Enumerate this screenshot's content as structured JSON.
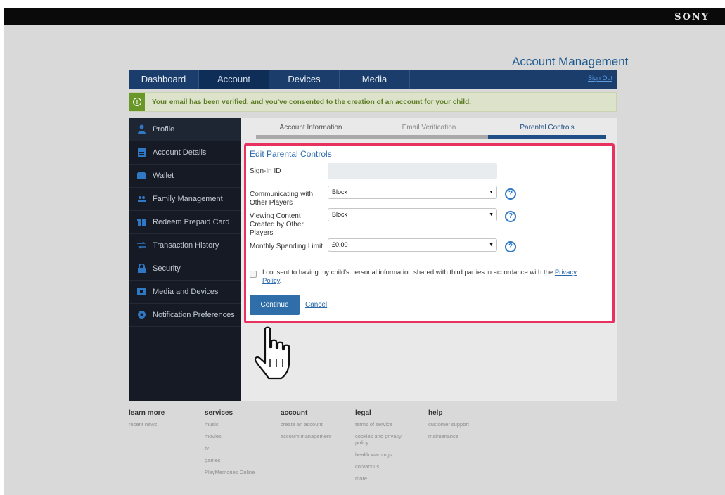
{
  "brand": "SONY",
  "page_title": "Account Management",
  "nav": {
    "tabs": [
      {
        "label": "Dashboard"
      },
      {
        "label": "Account"
      },
      {
        "label": "Devices"
      },
      {
        "label": "Media"
      }
    ],
    "signout": "Sign Out"
  },
  "banner": {
    "icon": "!",
    "text": "Your email has been verified, and you've consented to the creation of an account for your child."
  },
  "sidebar": {
    "items": [
      {
        "label": "Profile",
        "icon": "person-icon"
      },
      {
        "label": "Account Details",
        "icon": "document-icon"
      },
      {
        "label": "Wallet",
        "icon": "wallet-icon"
      },
      {
        "label": "Family Management",
        "icon": "family-icon"
      },
      {
        "label": "Redeem Prepaid Card",
        "icon": "gift-icon"
      },
      {
        "label": "Transaction History",
        "icon": "transfer-icon"
      },
      {
        "label": "Security",
        "icon": "lock-icon"
      },
      {
        "label": "Media and Devices",
        "icon": "media-icon"
      },
      {
        "label": "Notification Preferences",
        "icon": "gear-icon"
      }
    ]
  },
  "steps": {
    "items": [
      {
        "label": "Account Information"
      },
      {
        "label": "Email Verification"
      },
      {
        "label": "Parental Controls"
      }
    ]
  },
  "form": {
    "title": "Edit Parental Controls",
    "signin_label": "Sign-In ID",
    "signin_value": "",
    "communicating_label": "Communicating with Other Players",
    "communicating_value": "Block",
    "viewing_label": "Viewing Content Created by Other Players",
    "viewing_value": "Block",
    "spending_label": "Monthly Spending Limit",
    "spending_value": "£0.00",
    "help": "?",
    "dropdown_arrow": "▼",
    "consent_text": "I consent to having my child's personal information shared with third parties in accordance with the ",
    "consent_link": "Privacy Policy",
    "consent_end": ".",
    "continue_label": "Continue",
    "cancel_label": "Cancel"
  },
  "footer": {
    "columns": [
      {
        "heading": "learn more",
        "links": [
          "recent news"
        ]
      },
      {
        "heading": "services",
        "links": [
          "music",
          "movies",
          "tv",
          "games",
          "PlayMemories Online"
        ]
      },
      {
        "heading": "account",
        "links": [
          "create an account",
          "account management"
        ]
      },
      {
        "heading": "legal",
        "links": [
          "terms of service",
          "cookies and privacy policy",
          "health warnings",
          "contact us",
          "more..."
        ]
      },
      {
        "heading": "help",
        "links": [
          "customer support",
          "maintenance"
        ]
      }
    ]
  },
  "colors": {
    "nav_bg": "#1a3d6b",
    "sidebar_bg": "#151a24",
    "accent": "#2f6ea8",
    "highlight_border": "#e8315f",
    "banner_green": "#6a9828"
  }
}
